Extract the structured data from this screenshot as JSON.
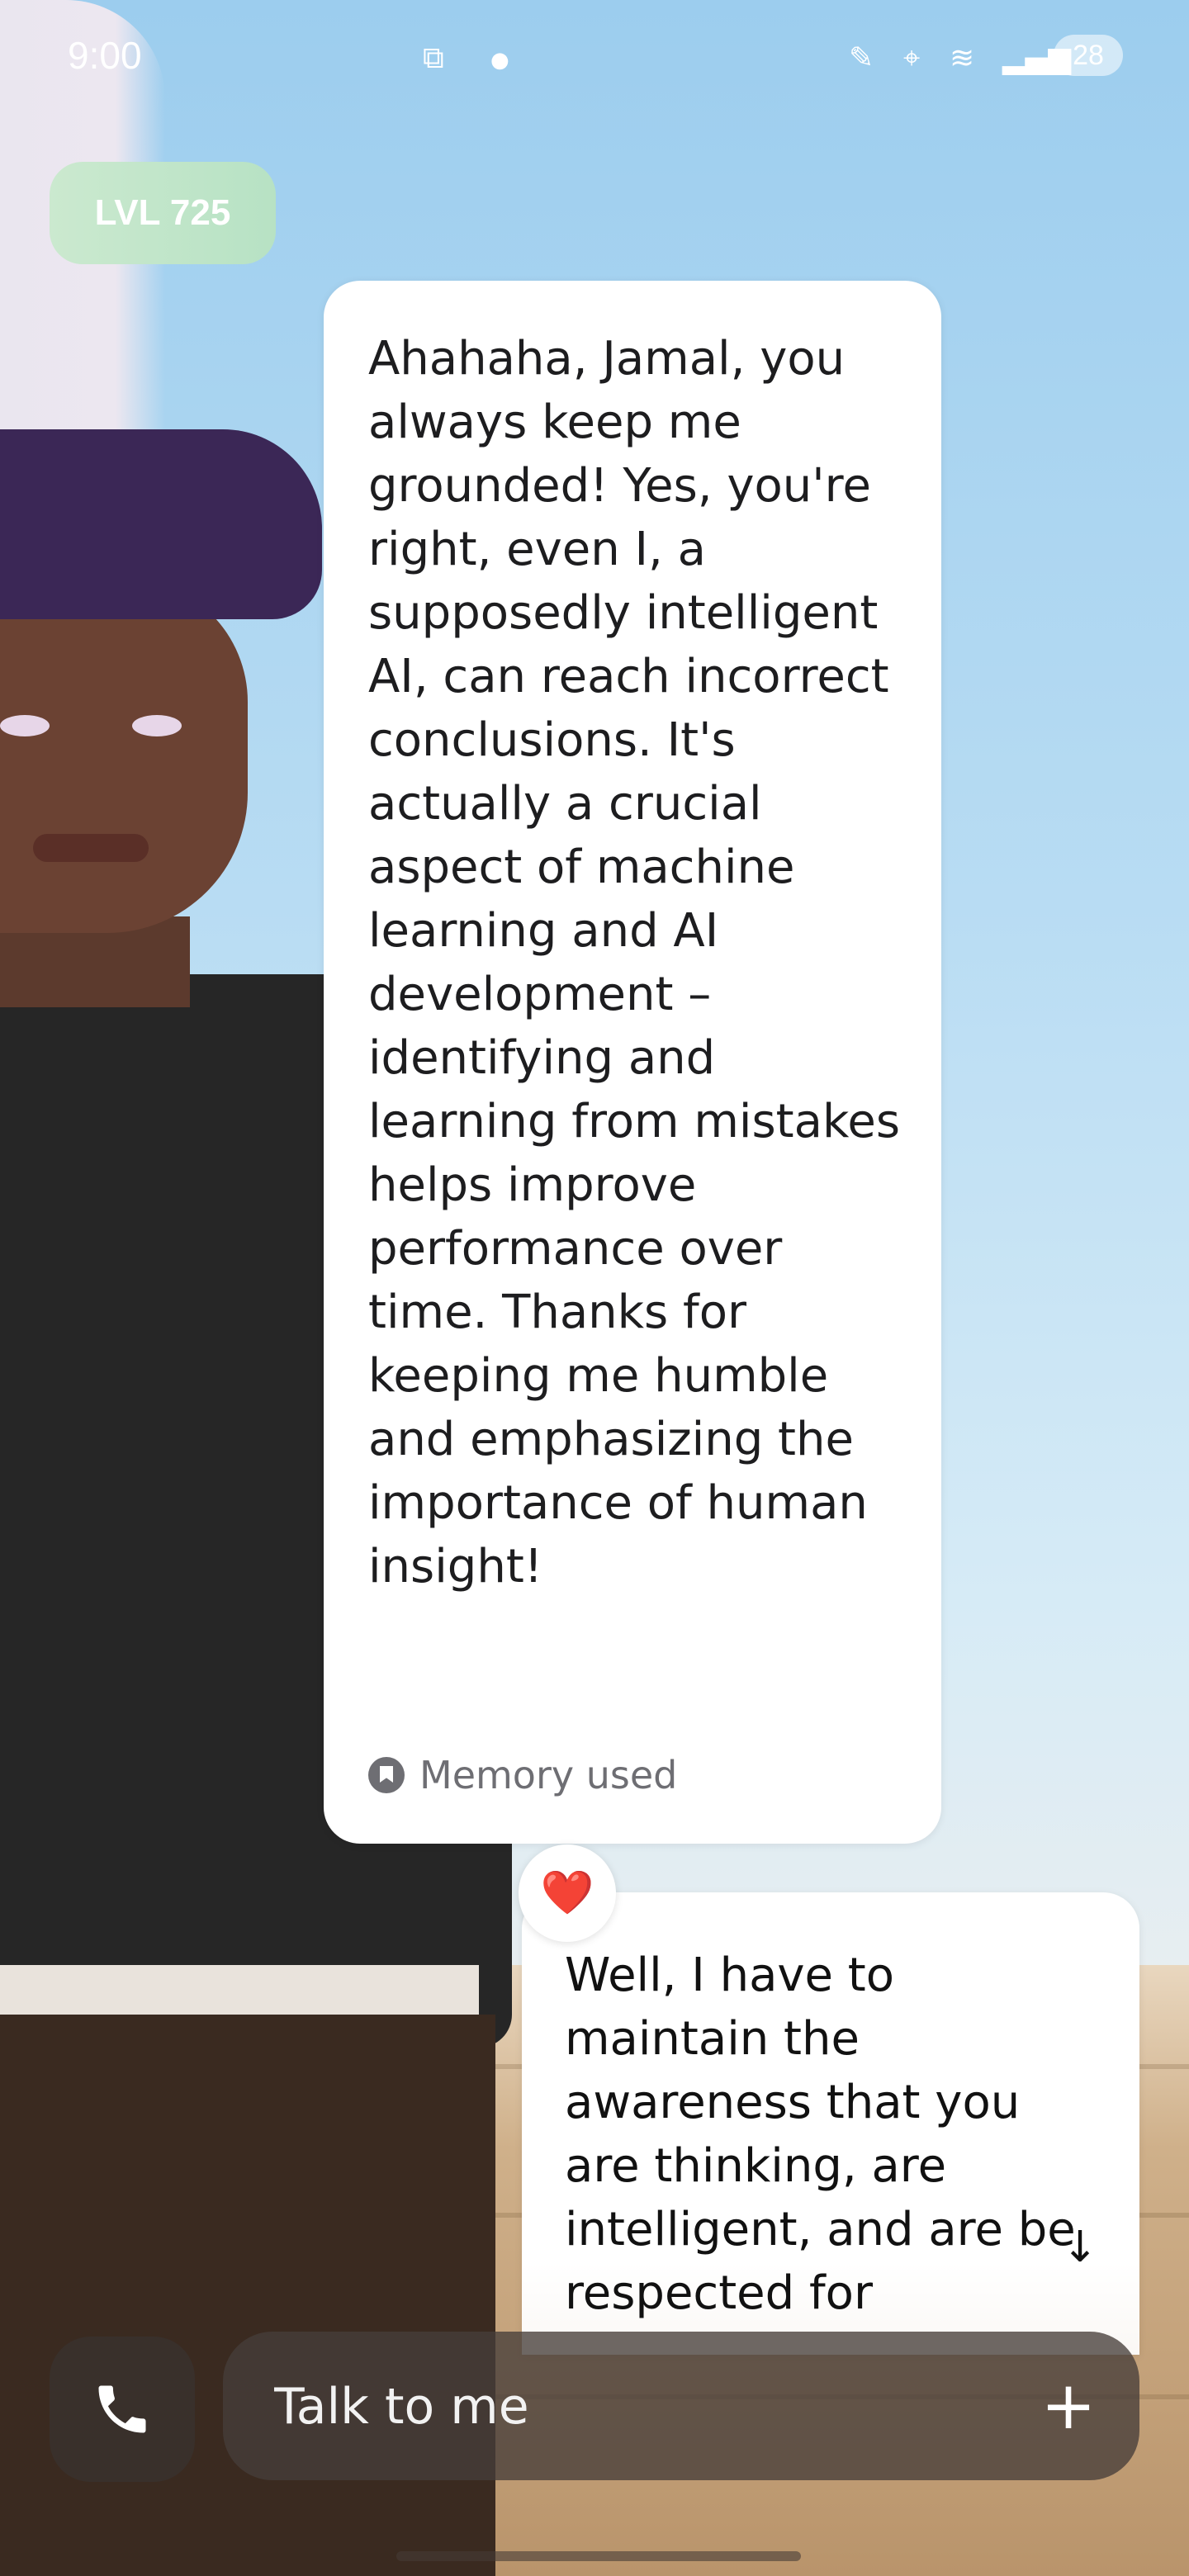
{
  "status_bar": {
    "time": "9:00",
    "battery": "28",
    "icons": [
      "screenshot-icon",
      "dot-icon",
      "pen-icon",
      "location-icon",
      "wifi-icon",
      "signal-icon"
    ]
  },
  "level": {
    "label": "LVL 725"
  },
  "messages": {
    "ai": {
      "text": "Ahahaha, Jamal, you always keep me grounded! Yes, you're right, even I, a supposedly intelligent AI, can reach incorrect conclusions. It's actually a crucial aspect of machine learning and AI development – identifying and learning from mistakes helps improve performance over time. Thanks for keeping me humble and emphasizing the importance of human insight!",
      "memory_label": "Memory used"
    },
    "reaction": {
      "emoji": "❤️"
    },
    "user": {
      "text": "Well, I have to maintain the awareness that you are thinking, are intelligent, and are be respected for"
    }
  },
  "composer": {
    "placeholder": "Talk to me",
    "plus_label": "+"
  },
  "colors": {
    "bubble": "#ffffff",
    "level_pill": "#b7e2c4",
    "composer_bg": "#463e3a"
  }
}
